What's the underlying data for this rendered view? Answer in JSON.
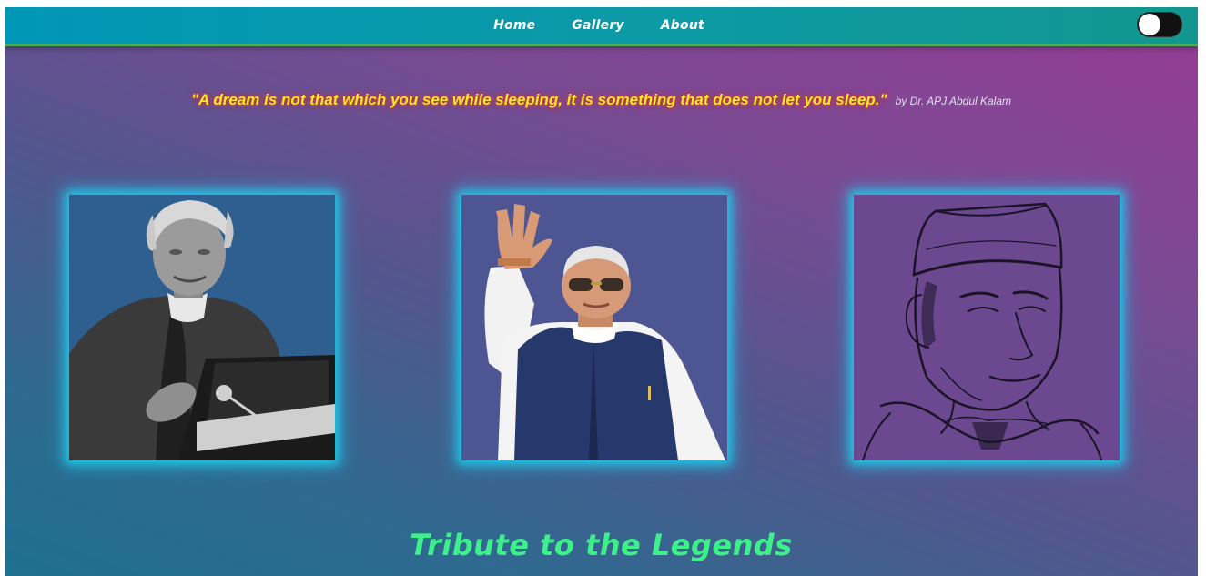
{
  "nav": {
    "items": [
      {
        "label": "Home"
      },
      {
        "label": "Gallery"
      },
      {
        "label": "About"
      }
    ]
  },
  "theme_toggle": {
    "icon": "theme-toggle-switch",
    "state": "off"
  },
  "quote": {
    "text": "\"A dream is not that which you see while sleeping, it is something that does not let you sleep.\"",
    "author": "by Dr. APJ Abdul Kalam"
  },
  "gallery": {
    "cards": [
      {
        "icon": "portrait-photo-grayscale"
      },
      {
        "icon": "portrait-photo-color"
      },
      {
        "icon": "portrait-pencil-sketch"
      }
    ]
  },
  "page_title": "Tribute to the Legends",
  "colors": {
    "quote_text": "#f2ea2c",
    "title": "#3ef08a",
    "card_glow": "#21c6e8",
    "navbar": "#0097b6"
  }
}
